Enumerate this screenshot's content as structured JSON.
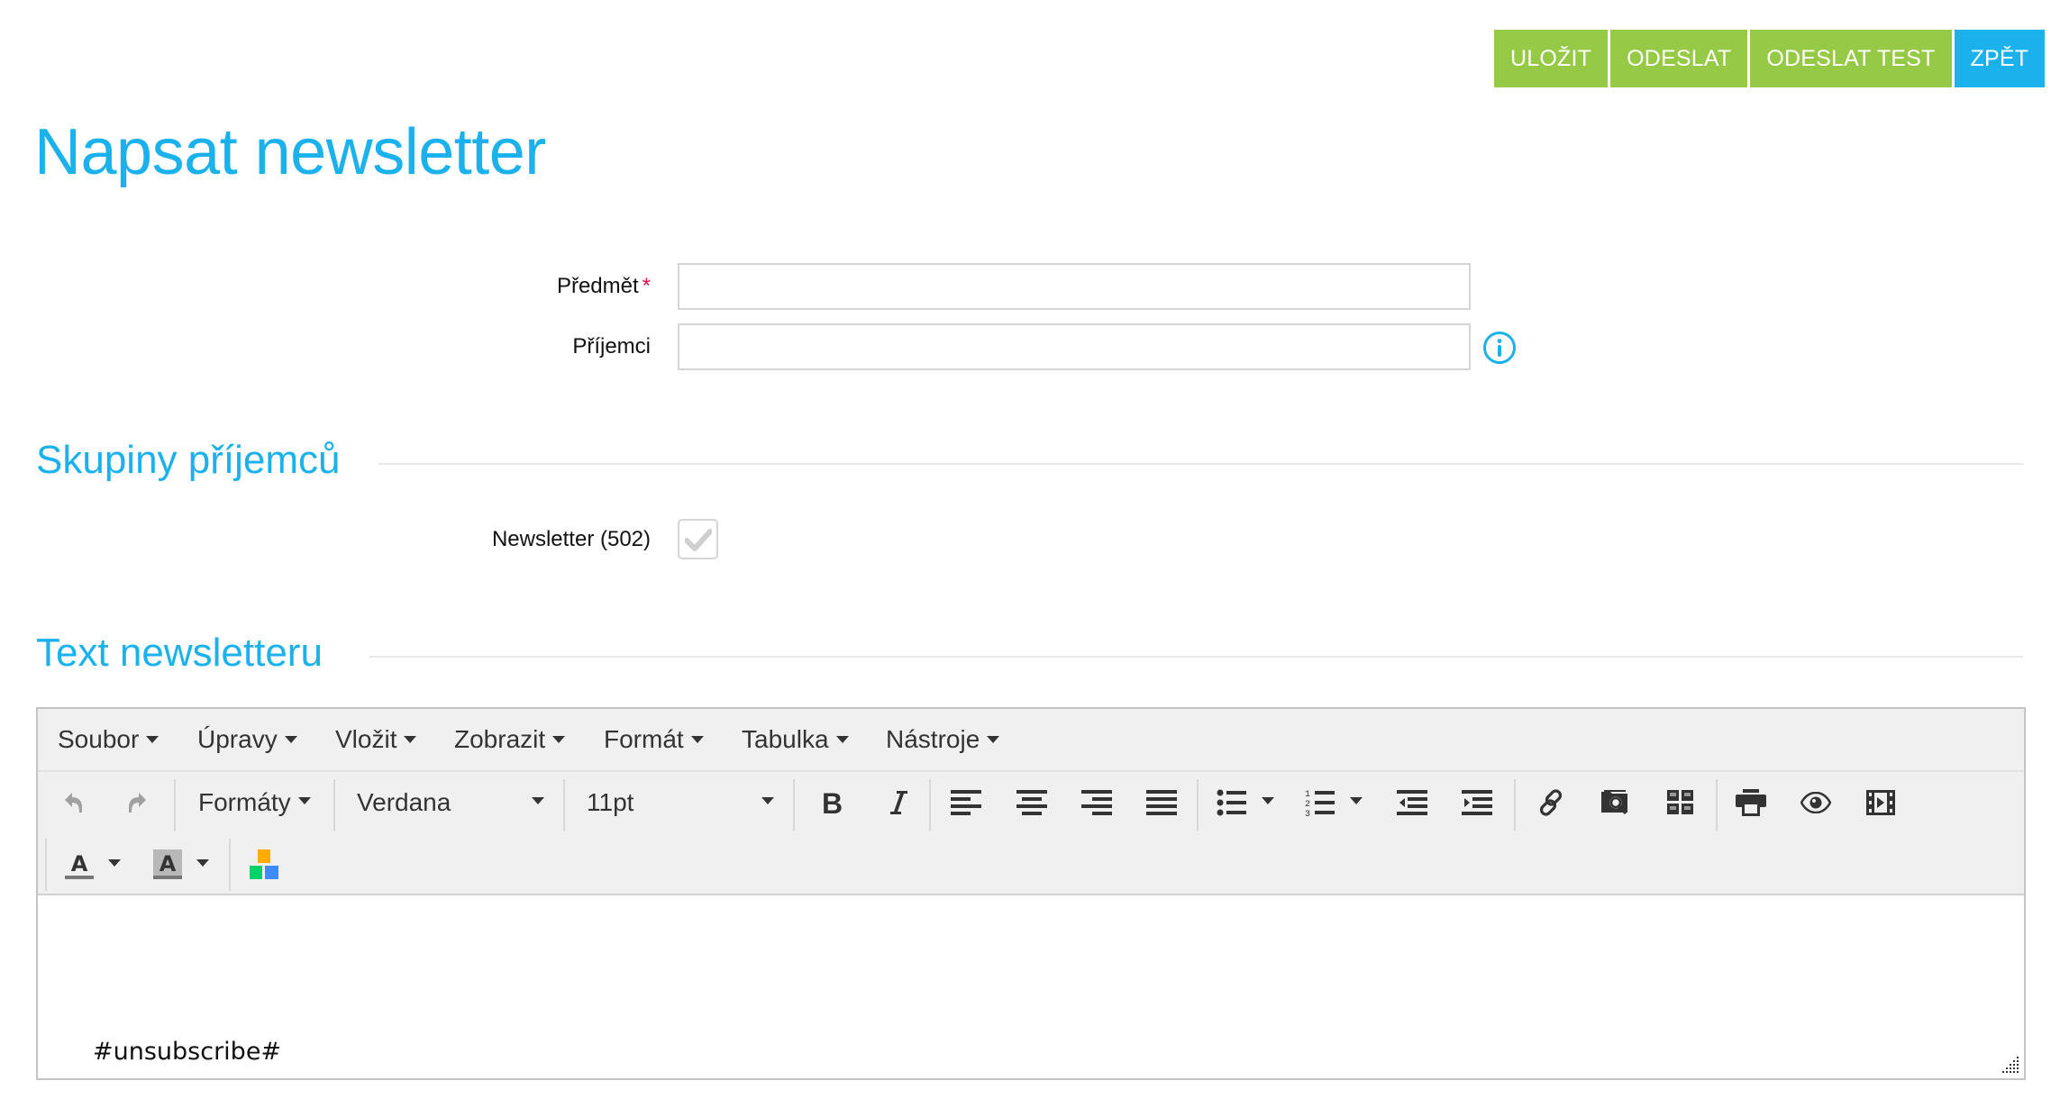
{
  "actions": {
    "save": "ULOŽIT",
    "send": "ODESLAT",
    "send_test": "ODESLAT TEST",
    "back": "ZPĚT"
  },
  "page": {
    "title": "Napsat newsletter"
  },
  "form": {
    "subject": {
      "label": "Předmět",
      "required_mark": "*",
      "value": "",
      "placeholder": ""
    },
    "recipients": {
      "label": "Příjemci",
      "value": "",
      "placeholder": "",
      "info_icon": "info-icon"
    }
  },
  "groups": {
    "heading": "Skupiny příjemců",
    "items": [
      {
        "label": "Newsletter (502)",
        "checked": true
      }
    ]
  },
  "text_section": {
    "heading": "Text newsletteru"
  },
  "editor": {
    "menu": [
      "Soubor",
      "Úpravy",
      "Vložit",
      "Zobrazit",
      "Formát",
      "Tabulka",
      "Nástroje"
    ],
    "toolbar": {
      "undo": "undo-icon",
      "redo": "redo-icon",
      "formats_label": "Formáty",
      "font_family": "Verdana",
      "font_size": "11pt",
      "buttons": [
        "bold",
        "italic",
        "align-left",
        "align-center",
        "align-right",
        "align-justify",
        "bullet-list",
        "numbered-list",
        "outdent",
        "indent",
        "link",
        "file-browser",
        "templates",
        "print",
        "preview",
        "media",
        "text-color",
        "background-color",
        "color-blocks"
      ]
    },
    "content": "#unsubscribe#"
  },
  "colors": {
    "accent_blue": "#1ab1ec",
    "accent_green": "#95c946",
    "required_red": "#e0174a"
  }
}
